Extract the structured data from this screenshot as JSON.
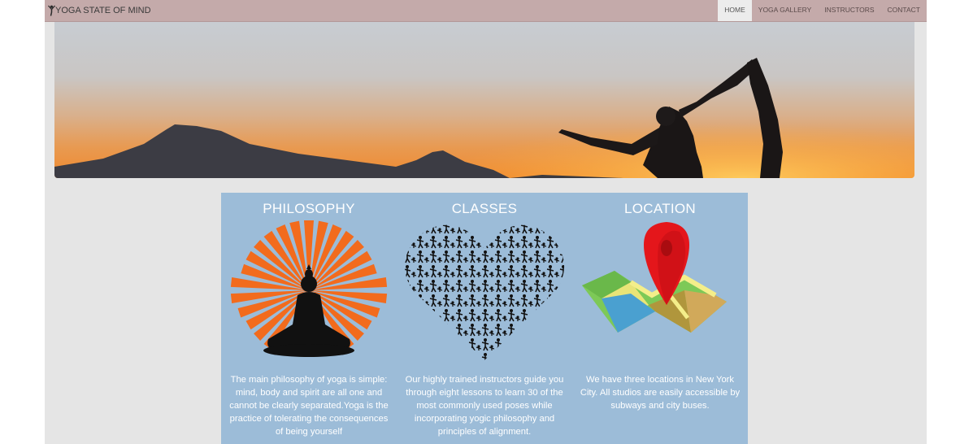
{
  "brand": {
    "title": "YOGA STATE OF MIND",
    "icon": "yoga-pose-icon"
  },
  "nav": {
    "items": [
      {
        "label": "HOME",
        "active": true
      },
      {
        "label": "YOGA GALLERY",
        "active": false
      },
      {
        "label": "INSTRUCTORS",
        "active": false
      },
      {
        "label": "CONTACT",
        "active": false
      }
    ]
  },
  "colors": {
    "navbar": "#c4aaaa",
    "page_background": "#e5e5e5",
    "features_background": "#9cbcd8",
    "sunburst": "#f26b1d",
    "map_pin": "#e4161b"
  },
  "features": [
    {
      "title": "PHILOSOPHY",
      "icon": "meditating-buddha-sunburst-icon",
      "text": "The main philosophy of yoga is simple: mind, body and spirit are all one and cannot be clearly separated.Yoga is the practice of tolerating the consequences of being yourself"
    },
    {
      "title": "CLASSES",
      "icon": "heart-of-yoga-poses-icon",
      "text": "Our highly trained instructors guide you through eight lessons to learn 30 of the most commonly used poses while incorporating yogic philosophy and principles of alignment."
    },
    {
      "title": "LOCATION",
      "icon": "map-pin-icon",
      "text": "We have three locations in New York City. All studios are easily accessible by subways and city buses."
    }
  ]
}
